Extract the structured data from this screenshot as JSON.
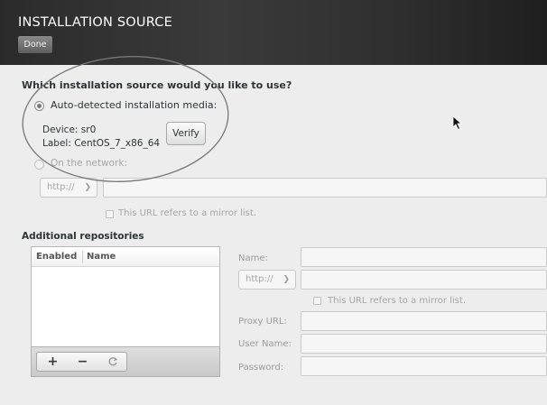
{
  "header": {
    "title": "INSTALLATION SOURCE",
    "done_label": "Done"
  },
  "source": {
    "question": "Which installation source would you like to use?",
    "auto_option_label": "Auto-detected installation media:",
    "auto_selected": true,
    "device_line": "Device: sr0",
    "label_line": "Label: CentOS_7_x86_64",
    "verify_label": "Verify",
    "network_option_label": "On the network:",
    "network_selected": false,
    "protocol_value": "http://",
    "url_value": "",
    "mirror_label": "This URL refers to a mirror list."
  },
  "repos": {
    "title": "Additional repositories",
    "columns": [
      "Enabled",
      "Name"
    ],
    "rows": [],
    "toolbar": {
      "add_label": "+",
      "remove_label": "−",
      "refresh_icon": "refresh-icon"
    },
    "form": {
      "name_label": "Name:",
      "name_value": "",
      "protocol_value": "http://",
      "url_value": "",
      "mirror_label": "This URL refers to a mirror list.",
      "proxy_label": "Proxy URL:",
      "proxy_value": "",
      "username_label": "User Name:",
      "username_value": "",
      "password_label": "Password:",
      "password_value": ""
    }
  },
  "colors": {
    "header_bg": "#2f2f2f",
    "page_bg": "#ededed",
    "annotation_ellipse": "#777777"
  }
}
